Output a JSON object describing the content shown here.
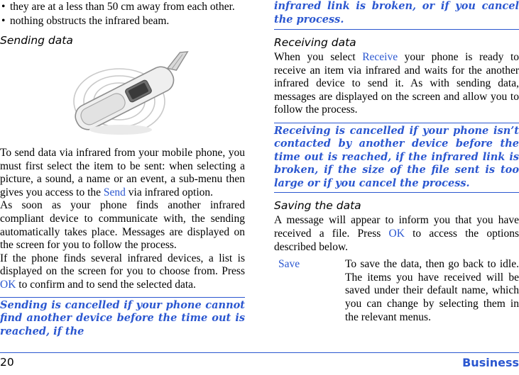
{
  "left_column": {
    "bullets": [
      "they are at a less than 50 cm away from each other.",
      "nothing obstructs the infrared beam."
    ],
    "section_title": "Sending data",
    "illustration_name": "infrared-phone-illustration",
    "paragraphs": [
      "To send data via infrared from your mobile phone, you must first select the item to be sent: when selecting a picture, a sound, a name or an event, a sub-menu then gives you access to the ",
      " via infrared option.",
      "As soon as your phone finds another infrared compliant device to communicate with, the sending automatically takes place. Messages are displayed on the screen for you to follow the process.",
      "If the phone finds several infrared devices, a list is displayed on the screen for you to choose from. Press ",
      " to confirm and to send the selected data."
    ],
    "key_send": "Send",
    "key_ok": "OK",
    "note": "Sending is cancelled if your phone cannot find another device before the time out is reached, if the"
  },
  "right_column": {
    "note_continued": "infrared link is broken, or if you cancel the process.",
    "receiving": {
      "title": "Receiving data",
      "text_1": "When you select ",
      "key": "Receive",
      "text_2": " your phone is ready to receive an item via infrared and waits for the another infrared device to send it. As with sending data, messages are displayed on the screen and allow you to follow the process.",
      "note": "Receiving is cancelled if your phone isn’t contacted by another device before the time out is reached, if the infrared link is broken, if the size of the file sent is too large or if you cancel the process."
    },
    "saving": {
      "title": "Saving the data",
      "text_1": "A message will appear to inform you that you have received a file. Press ",
      "key": "OK",
      "text_2": " to access the options described below.",
      "row": {
        "term": "Save",
        "desc": "To save the data, then go back to idle. The items you have received will be saved under their default name, which you can change by selecting them in the relevant menus."
      }
    }
  },
  "footer": {
    "page_number": "20",
    "chapter": "Business"
  },
  "colors": {
    "accent": "#2b57d0",
    "text": "#000000",
    "background": "#ffffff"
  }
}
